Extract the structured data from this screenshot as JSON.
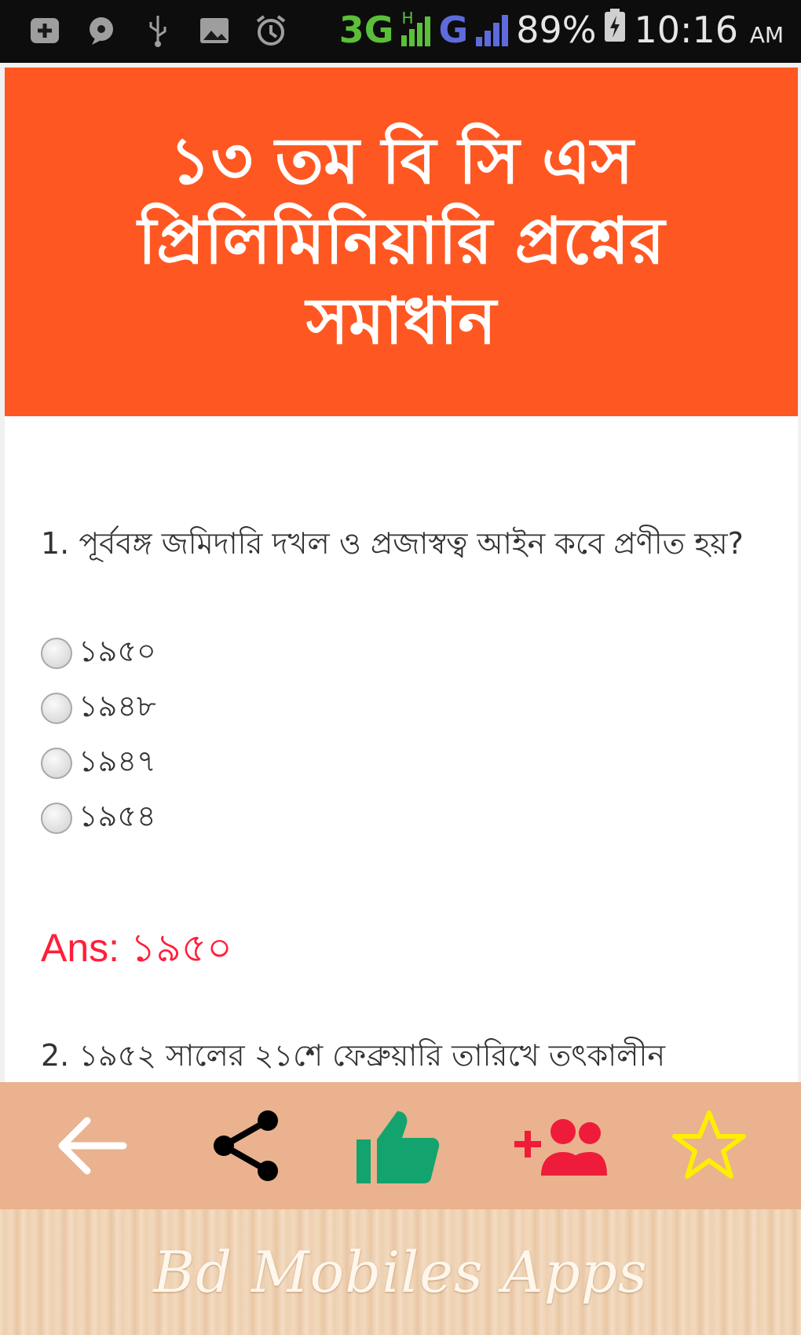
{
  "status_bar": {
    "network_3g": "3G",
    "network_h": "H",
    "network_g": "G",
    "battery_percent": "89%",
    "time": "10:16",
    "time_suffix": "AM"
  },
  "header": {
    "title": "১৩ তম বি সি এস প্রিলিমিনিয়ারি প্রশ্নের সমাধান",
    "bg_color": "#ff5722"
  },
  "questions": [
    {
      "text": "1. পূর্ববঙ্গ জমিদারি দখল ও প্রজাস্বত্ব আইন কবে প্রণীত হয়?",
      "options": [
        "১৯৫০",
        "১৯৪৮",
        "১৯৪৭",
        "১৯৫৪"
      ],
      "answer": "Ans: ১৯৫০"
    },
    {
      "text": "2. ১৯৫২ সালের ২১শে ফেব্রুয়ারি তারিখে তৎকালীন"
    }
  ],
  "toolbar": {
    "back": "arrow-left-icon",
    "share": "share-icon",
    "like": "thumbs-up-icon",
    "add_friends": "add-group-icon",
    "favorite": "star-icon",
    "colors": {
      "bg": "#eab28e",
      "like": "#13a36e",
      "add": "#ee1c3a",
      "star": "#ffee00"
    }
  },
  "banner": {
    "text": "Bd Mobiles Apps"
  }
}
